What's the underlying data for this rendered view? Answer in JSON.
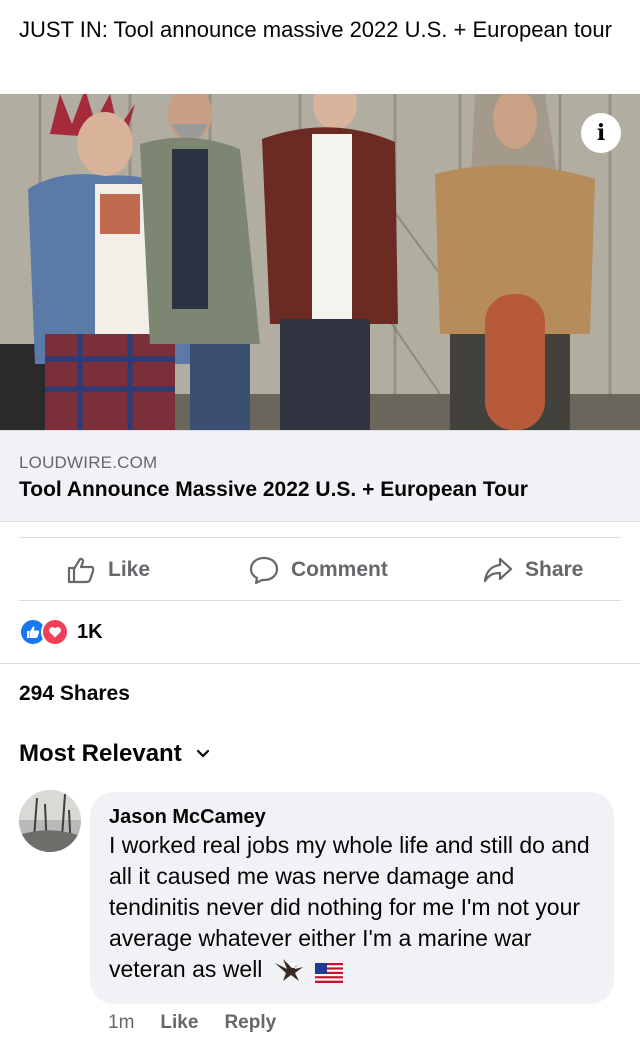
{
  "post": {
    "text": "JUST IN: Tool announce massive 2022 U.S. + European tour"
  },
  "link_card": {
    "domain": "LOUDWIRE.COM",
    "title": "Tool Announce Massive 2022 U.S. + European Tour",
    "info_icon": "info-icon",
    "info_glyph": "i"
  },
  "actions": {
    "like": "Like",
    "comment": "Comment",
    "share": "Share"
  },
  "reactions": {
    "count": "1K",
    "types": [
      "like",
      "love"
    ]
  },
  "shares": "294 Shares",
  "sort": {
    "label": "Most Relevant"
  },
  "comment": {
    "author": "Jason McCamey",
    "text": "I worked real jobs my whole life and still do and all it caused me was nerve damage and tendinitis never did nothing for me I'm not your average whatever either I'm a marine war veteran as well",
    "emojis": [
      "eagle",
      "us-flag"
    ],
    "time": "1m",
    "like_label": "Like",
    "reply_label": "Reply"
  },
  "colors": {
    "like_blue": "#1877f2",
    "love_red": "#f33e58",
    "meta_gray": "#65676b",
    "card_bg": "#f0f2f5"
  }
}
